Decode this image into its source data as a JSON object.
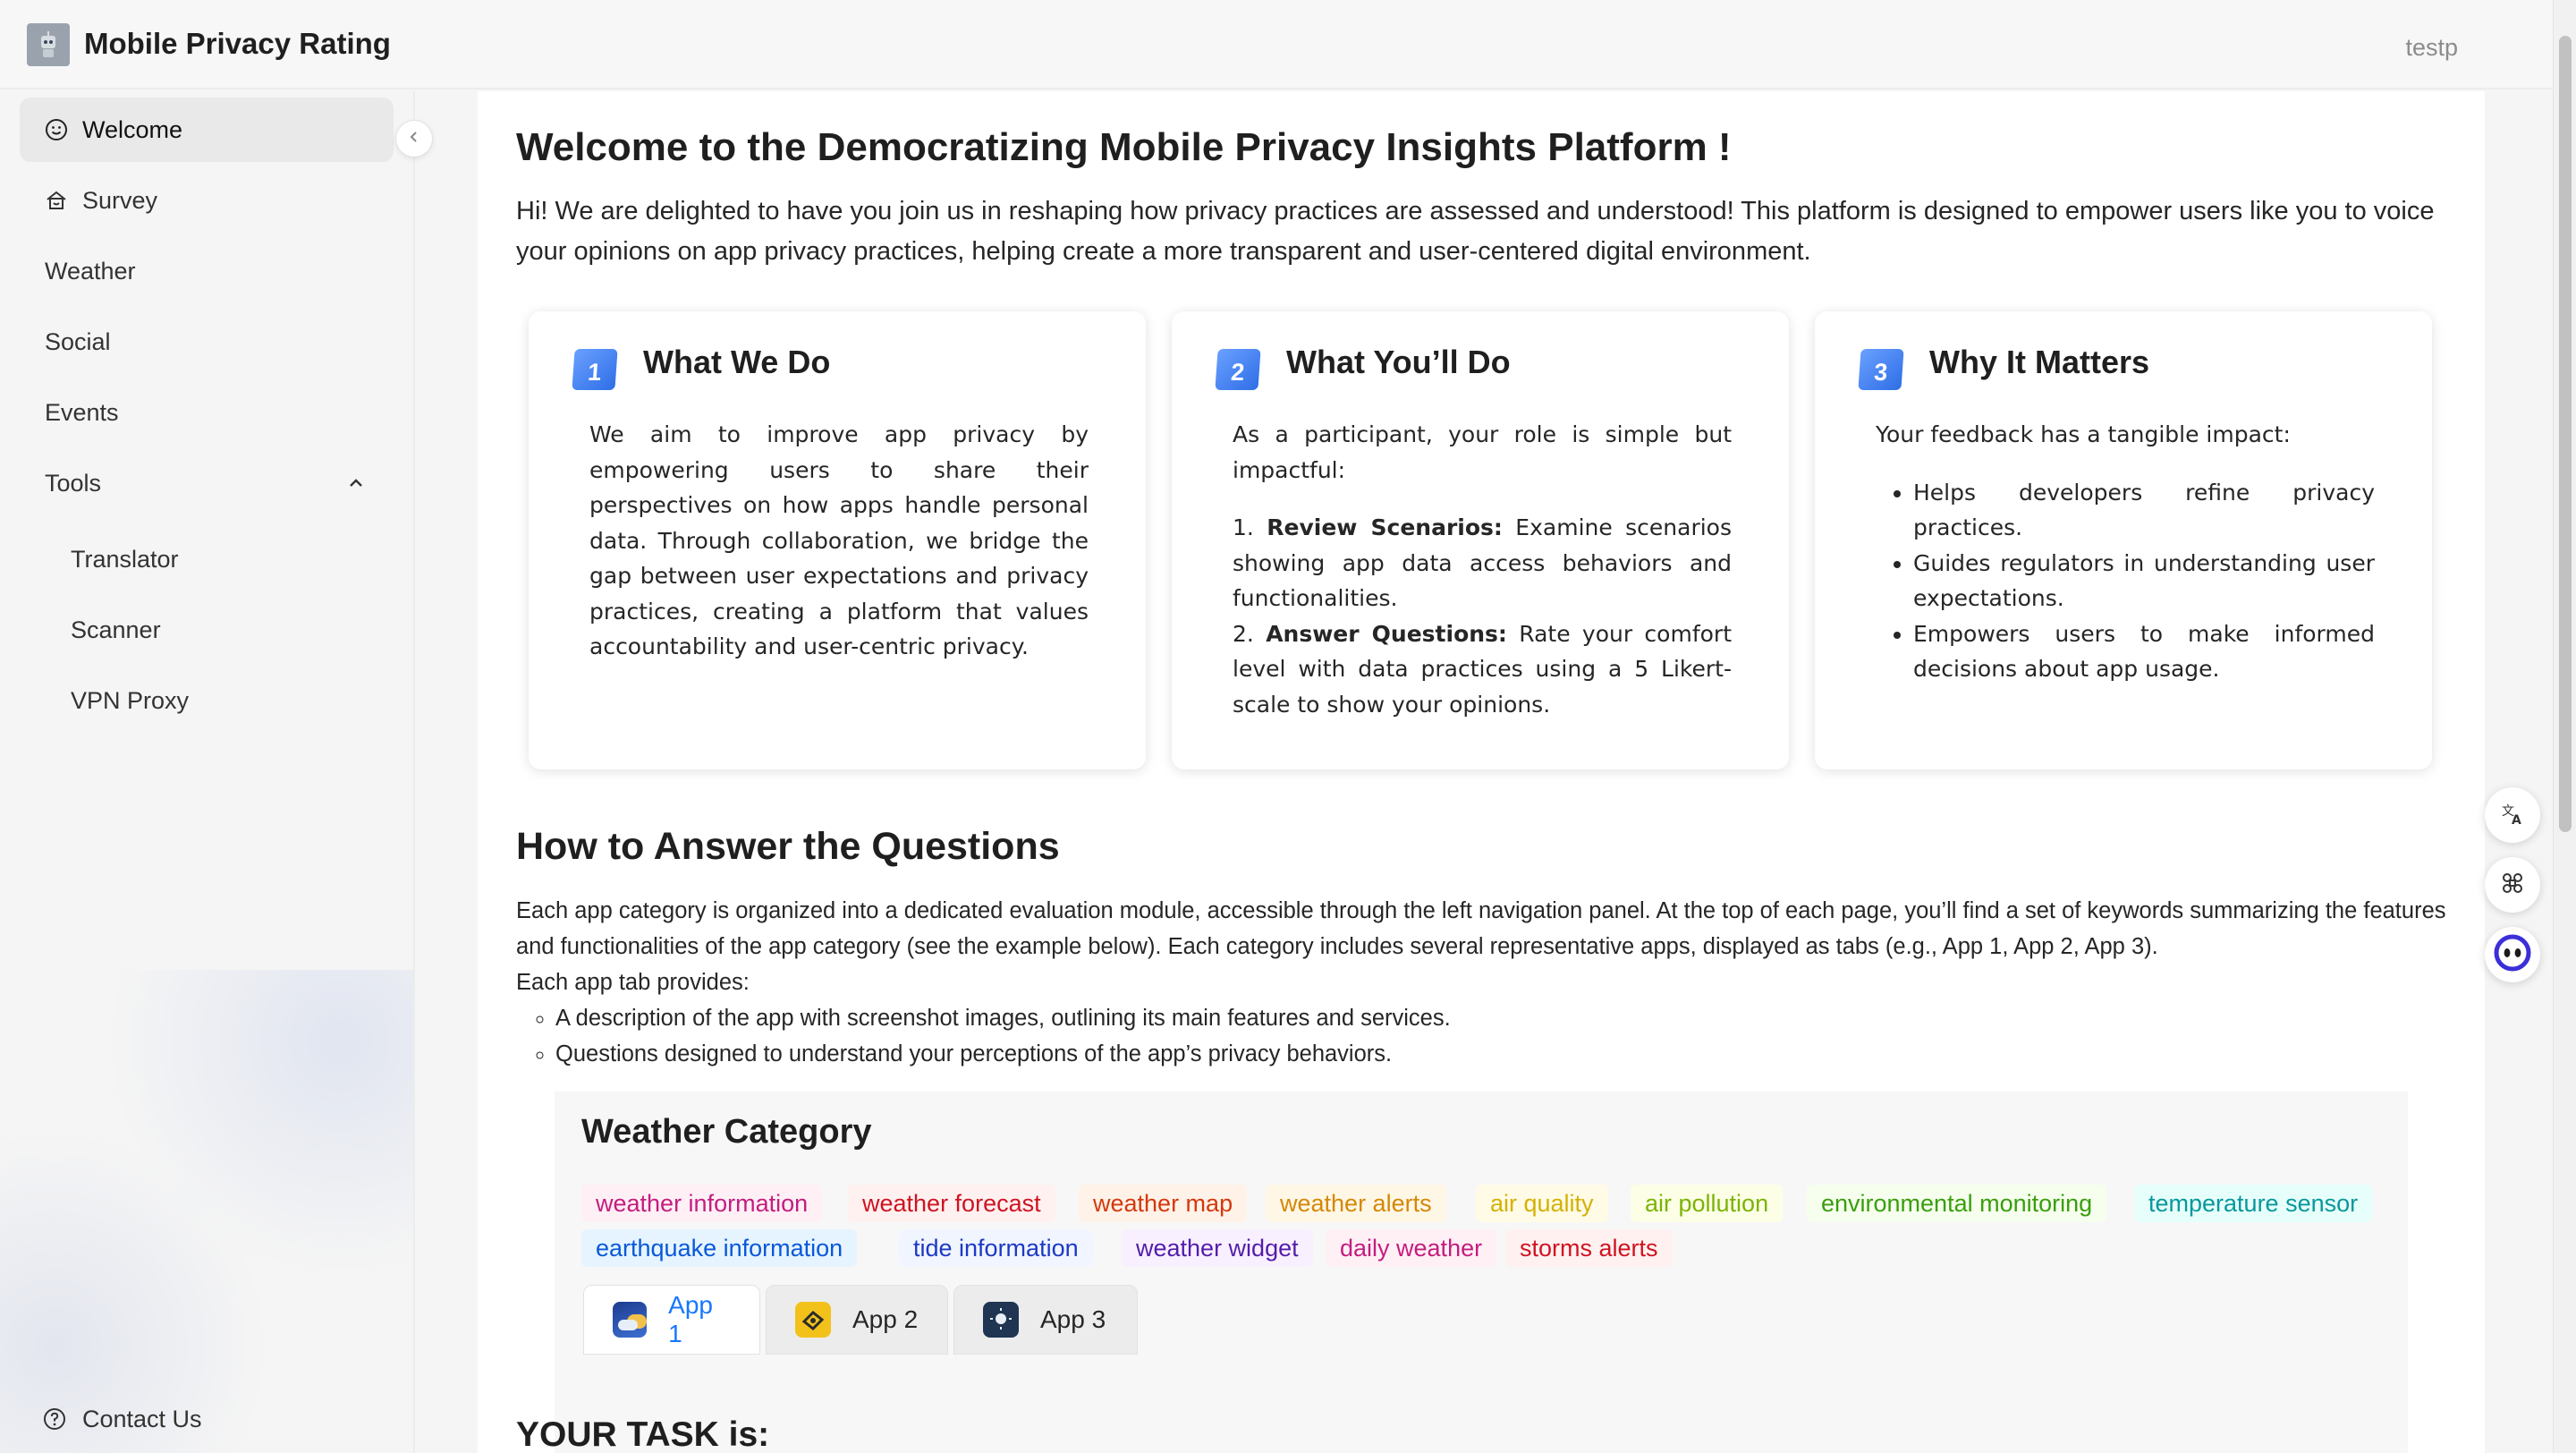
{
  "header": {
    "app_title": "Mobile Privacy Rating",
    "user": "testp"
  },
  "sidebar": {
    "items": [
      {
        "label": "Welcome",
        "icon": "smile-icon",
        "active": true
      },
      {
        "label": "Survey",
        "icon": "home-icon"
      },
      {
        "label": "Weather"
      },
      {
        "label": "Social"
      },
      {
        "label": "Events"
      },
      {
        "label": "Tools",
        "expanded": true
      }
    ],
    "sub_items": [
      {
        "label": "Translator"
      },
      {
        "label": "Scanner"
      },
      {
        "label": "VPN Proxy"
      }
    ],
    "contact": "Contact Us"
  },
  "main": {
    "title": "Welcome to the Democratizing Mobile Privacy Insights Platform !",
    "intro": "Hi! We are delighted to have you join us in reshaping how privacy practices are assessed and understood! This platform is designed to empower users like you to voice your opinions on app privacy practices, helping create a more transparent and user-centered digital environment.",
    "cards": [
      {
        "num": "1",
        "title": "What We Do",
        "body": "We aim to improve app privacy by empowering users to share their perspectives on how apps handle personal data. Through collaboration, we bridge the gap between user expectations and privacy practices, creating a platform that values accountability and user-centric privacy."
      },
      {
        "num": "2",
        "title": "What You’ll Do",
        "lead": "As a participant, your role is simple but impactful:",
        "step1_num": "1.",
        "step1_bold": "Review Scenarios:",
        "step1_text": " Examine scenarios showing app data access behaviors and functionalities.",
        "step2_num": "2.",
        "step2_bold": "Answer Questions:",
        "step2_text": " Rate your comfort level with data practices using a 5 Likert-scale to show your opinions."
      },
      {
        "num": "3",
        "title": "Why It Matters",
        "lead": "Your feedback has a tangible impact:",
        "bullets": [
          "Helps developers refine privacy practices.",
          "Guides regulators in understanding user expectations.",
          "Empowers users to make informed decisions about app usage."
        ]
      }
    ],
    "howto_title": "How to Answer the Questions",
    "howto_para": "Each app category is organized into a dedicated evaluation module, accessible through the left navigation panel. At the top of each page, you’ll find a set of keywords summarizing the features and functionalities of the app category (see the example below). Each category includes several representative apps, displayed as tabs (e.g., App 1, App 2, App 3).",
    "howto_lead": "Each app tab provides:",
    "howto_items": [
      "A description of the app with screenshot images, outlining its main features and services.",
      "Questions designed to understand your perceptions of the app’s privacy behaviors."
    ],
    "category": {
      "title": "Weather Category",
      "tags": [
        {
          "label": "weather information",
          "color": "#c41d7f",
          "bg": "#fff0f6"
        },
        {
          "label": "weather forecast",
          "color": "#cf1322",
          "bg": "#fff1f0"
        },
        {
          "label": "weather map",
          "color": "#d4380d",
          "bg": "#fff2e8"
        },
        {
          "label": "weather alerts",
          "color": "#d48806",
          "bg": "#fff7e6"
        },
        {
          "label": "air quality",
          "color": "#d4b106",
          "bg": "#fffbe6"
        },
        {
          "label": "air pollution",
          "color": "#7cb305",
          "bg": "#fcffe6"
        },
        {
          "label": "environmental monitoring",
          "color": "#389e0d",
          "bg": "#f6ffed"
        },
        {
          "label": "temperature sensor",
          "color": "#08979c",
          "bg": "#e6fffb"
        },
        {
          "label": "earthquake information",
          "color": "#0958d9",
          "bg": "#e6f4ff"
        },
        {
          "label": "tide information",
          "color": "#1d39c4",
          "bg": "#f0f5ff"
        },
        {
          "label": "weather widget",
          "color": "#531dab",
          "bg": "#f9f0ff"
        },
        {
          "label": "daily weather",
          "color": "#c41d7f",
          "bg": "#fff0f6"
        },
        {
          "label": "storms alerts",
          "color": "#cf1322",
          "bg": "#fff1f0"
        }
      ],
      "tabs": [
        {
          "label": "App 1",
          "icon": "weather-app-icon"
        },
        {
          "label": "App 2",
          "icon": "weather-app-icon"
        },
        {
          "label": "App 3",
          "icon": "weather-app-icon"
        }
      ]
    },
    "task_title": "YOUR TASK is:"
  }
}
